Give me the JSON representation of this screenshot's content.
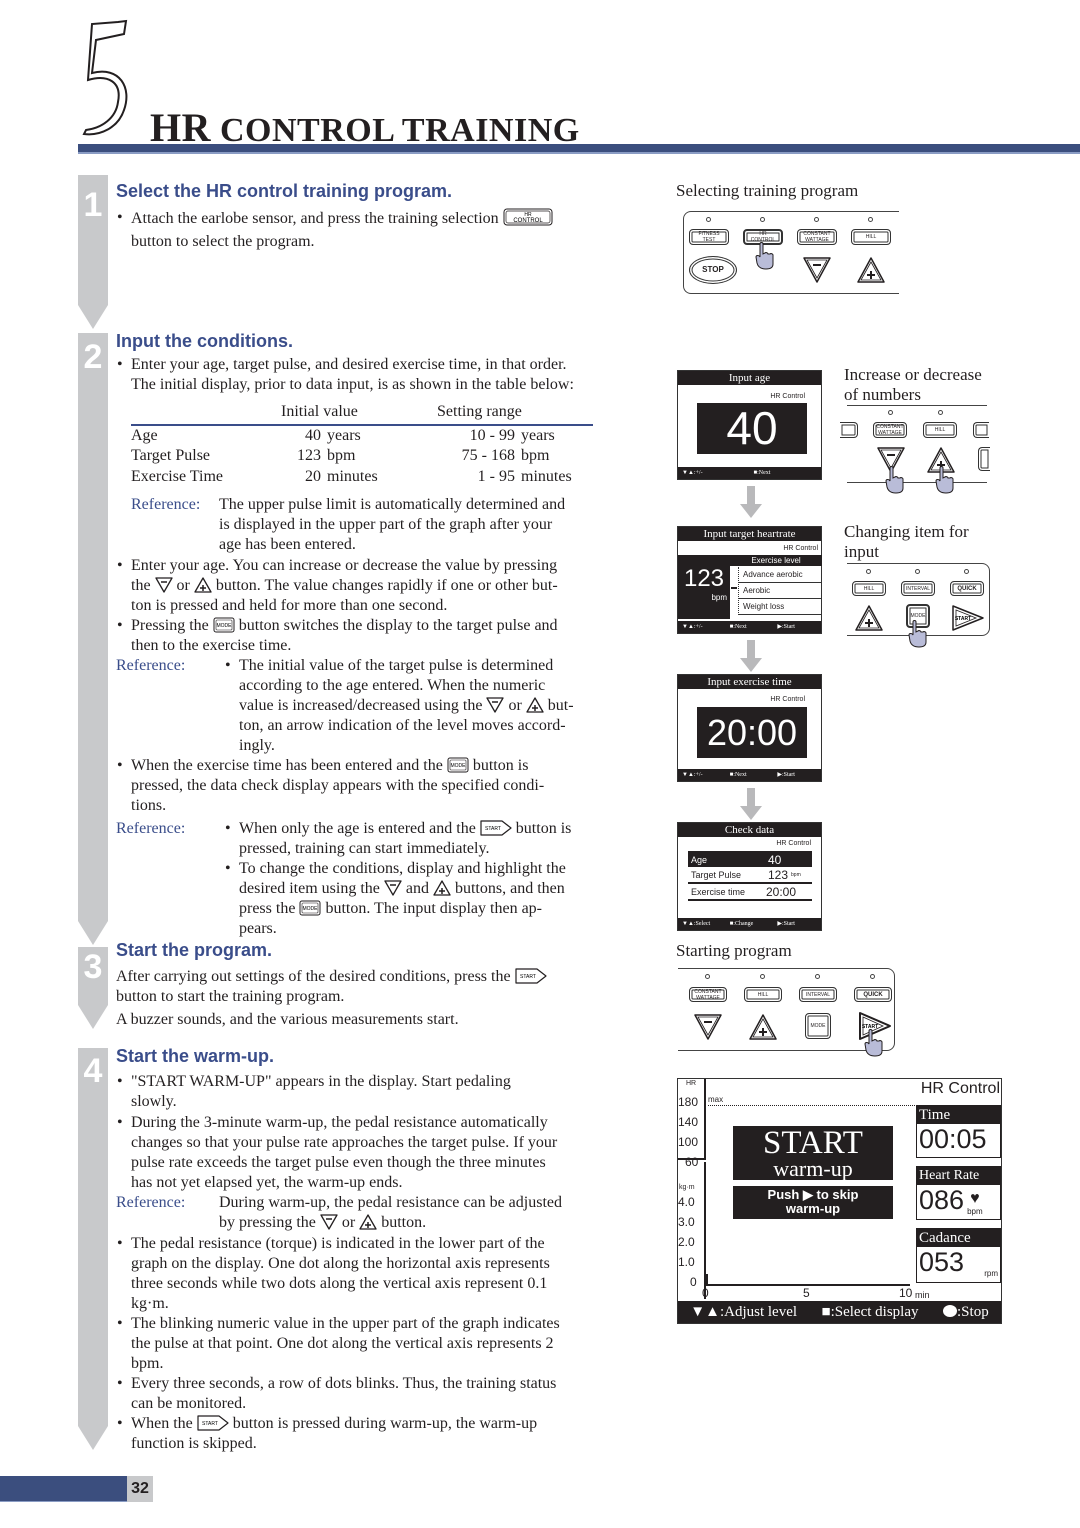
{
  "chapter": {
    "number": "5",
    "title_big": "HR",
    "title_rest": "CONTROL TRAINING"
  },
  "colors": {
    "accent_blue": "#3a4d8a",
    "rule_blue": "#3b4e7e",
    "step_gray": "#c8c9cb"
  },
  "steps": [
    {
      "num": "1",
      "heading": "Select the HR control training program.",
      "text_a": "Attach the earlobe sensor, and press the training selection",
      "text_b": "button to select the program."
    },
    {
      "num": "2",
      "heading": "Input the conditions.",
      "intro_1": "Enter your age, target pulse, and desired exercise time, in that order.",
      "intro_2": "The initial display, prior to data input, is as shown in the table below:",
      "table": {
        "headers": [
          "",
          "Initial value",
          "Setting range"
        ],
        "rows": [
          {
            "item": "Age",
            "init": "40",
            "init_unit": "years",
            "range": "10 - 99",
            "range_unit": "years"
          },
          {
            "item": "Target Pulse",
            "init": "123",
            "init_unit": "bpm",
            "range": "75 - 168",
            "range_unit": "bpm"
          },
          {
            "item": "Exercise Time",
            "init": "20",
            "init_unit": "minutes",
            "range": "1 - 95",
            "range_unit": "minutes"
          }
        ]
      },
      "ref_label": "Reference:",
      "ref1": [
        "The upper pulse limit is automatically determined and",
        "is displayed in the upper part of the graph after your",
        "age has been entered."
      ],
      "b1": [
        "Enter your age. You can increase or decrease the value by pressing",
        "the",
        "or",
        "button. The value changes rapidly if one or other but-",
        "ton is pressed and held for more than one second."
      ],
      "b2": [
        "Pressing the",
        "button switches the display to the target pulse and",
        "then to the exercise time."
      ],
      "ref2": [
        "The initial value of the target pulse is determined",
        "according to the age entered. When the numeric",
        "value is increased/decreased using the",
        "or",
        "but-",
        "ton, an arrow indication of the level moves accord-",
        "ingly."
      ],
      "b3": [
        "When the exercise time has been entered and the",
        "button is",
        "pressed, the data check display appears with the specified condi-",
        "tions."
      ],
      "ref3a": [
        "When only the age is entered and the",
        "button is",
        "pressed, training can start immediately."
      ],
      "ref3b": [
        "To change the conditions, display and highlight the",
        "desired item using the",
        "and",
        "buttons, and then",
        "press the",
        "button. The input display then ap-",
        "pears."
      ]
    },
    {
      "num": "3",
      "heading": "Start the program.",
      "l1": "After carrying out settings of the desired conditions, press the",
      "l2": "button to start the training program.",
      "l3": "A buzzer sounds, and the various measurements start."
    },
    {
      "num": "4",
      "heading": "Start the warm-up.",
      "b1": [
        "\"START WARM-UP\" appears in the display. Start pedaling",
        "slowly."
      ],
      "b2": [
        "During the 3-minute warm-up, the pedal resistance automatically",
        "changes so that your pulse rate approaches the target pulse. If your",
        "pulse rate exceeds the target pulse even though the three minutes",
        "has not yet elapsed yet, the warm-up ends."
      ],
      "ref": [
        "During warm-up, the pedal resistance can be adjusted",
        "by pressing the",
        "or",
        "button."
      ],
      "b3": [
        "The pedal resistance (torque) is indicated in the lower part of the",
        "graph on the display. One dot along the horizontal axis represents",
        "three seconds while two dots along the vertical axis represent 0.1",
        "kg·m."
      ],
      "b4": [
        "The blinking numeric value in the upper part of the graph indicates",
        "the pulse at that point. One dot along the vertical axis represents 2",
        "bpm."
      ],
      "b5": [
        "Every three seconds, a row of dots blinks. Thus, the training status",
        "can be monitored."
      ],
      "b6": [
        "When the",
        "button is pressed during warm-up, the warm-up",
        "function is skipped."
      ]
    }
  ],
  "btn_labels": {
    "hr": "HR",
    "control": "CONTROL",
    "mode": "MODE",
    "start": "START",
    "fitness": "FITNESS",
    "test": "TEST",
    "constant": "CONSTANT",
    "wattage": "WATTAGE",
    "hill": "HILL",
    "interval": "INTERVAL",
    "quick": "QUICK",
    "stop": "STOP"
  },
  "captions": {
    "selecting": "Selecting training program",
    "incdec_1": "Increase or decrease",
    "incdec_2": "of numbers",
    "changing_1": "Changing item for",
    "changing_2": "input",
    "starting": "Starting program"
  },
  "screens": {
    "mode_label": "HR Control",
    "age": {
      "title": "Input age",
      "value": "40",
      "foot": [
        "▼▲:+/-",
        "■:Next"
      ]
    },
    "heart": {
      "title": "Input target heartrate",
      "value": "123",
      "unit": "bpm",
      "level_title": "Exercise level",
      "levels": [
        "Advance aerobic",
        "Aerobic",
        "Weight loss"
      ],
      "foot": [
        "▼▲:+/-",
        "■:Next",
        "▶:Start"
      ]
    },
    "time": {
      "title": "Input exercise time",
      "value": "20:00",
      "foot": [
        "▼▲:+/-",
        "■:Next",
        "▶:Start"
      ]
    },
    "check": {
      "title": "Check data",
      "rows": [
        {
          "k": "Age",
          "v": "40",
          "u": ""
        },
        {
          "k": "Target Pulse",
          "v": "123",
          "u": "bpm"
        },
        {
          "k": "Exercise time",
          "v": "20:00",
          "u": ""
        }
      ],
      "foot": [
        "▼▲:Select",
        "■:Change",
        "▶:Start"
      ]
    }
  },
  "warmup": {
    "hr_label": "HR",
    "hr_ticks": [
      "180",
      "140",
      "100",
      "60"
    ],
    "max_label": "max",
    "kgm_label": "kg·m",
    "kgm_ticks": [
      "4.0",
      "3.0",
      "2.0",
      "1.0",
      "0"
    ],
    "x_ticks": [
      "0",
      "5",
      "10"
    ],
    "x_unit": "min",
    "banner_1": "START",
    "banner_2": "warm-up",
    "skip_1": "Push ▶ to skip",
    "skip_2": "warm-up",
    "mode": "HR Control",
    "time_label": "Time",
    "time_value": "00:05",
    "hr_rate_label": "Heart Rate",
    "hr_rate_value": "086",
    "hr_rate_unit": "bpm",
    "cad_label": "Cadance",
    "cad_value": "053",
    "cad_unit": "rpm",
    "foot_adjust": "▼▲:Adjust level",
    "foot_select": "■:Select display",
    "foot_stop": ":Stop"
  },
  "page_number": "32"
}
